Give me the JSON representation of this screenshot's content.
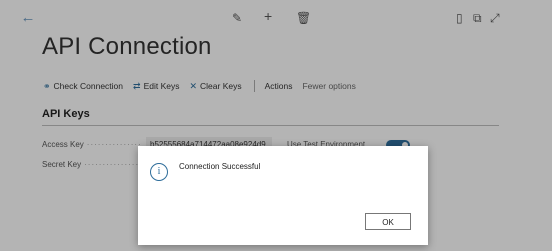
{
  "header": {
    "back_icon": "←",
    "tools": [
      {
        "name": "edit-icon",
        "glyph": "✎"
      },
      {
        "name": "add-icon",
        "glyph": "+"
      },
      {
        "name": "delete-icon",
        "glyph": "🗑"
      },
      {
        "name": "bookmark-icon",
        "glyph": "▯"
      },
      {
        "name": "open-new-window-icon",
        "glyph": "⧉"
      },
      {
        "name": "expand-icon",
        "glyph": "⤢"
      }
    ]
  },
  "page_title": "API Connection",
  "actions": [
    {
      "name": "check-connection-action",
      "icon": "⚭",
      "icon_color": "#2e6d9a",
      "label": "Check Connection"
    },
    {
      "name": "edit-keys-action",
      "icon": "⇄",
      "icon_color": "#2e6d9a",
      "label": "Edit Keys"
    },
    {
      "name": "clear-keys-action",
      "icon": "✕",
      "icon_color": "#2e6d9a",
      "label": "Clear Keys"
    }
  ],
  "menu": {
    "actions_label": "Actions",
    "fewer_options_label": "Fewer options"
  },
  "section": {
    "title": "API Keys"
  },
  "fields": {
    "access_key_label": "Access Key",
    "access_key_value": "b52555684a714472aa08e924d9...",
    "secret_key_label": "Secret Key",
    "test_env_label": "Use Test Environment",
    "test_env_on": true
  },
  "dialog": {
    "icon": "i",
    "message": "Connection Successful",
    "ok_label": "OK"
  },
  "colors": {
    "accent": "#2e6d9a",
    "overlay": "rgba(0,0,0,0.28)"
  }
}
